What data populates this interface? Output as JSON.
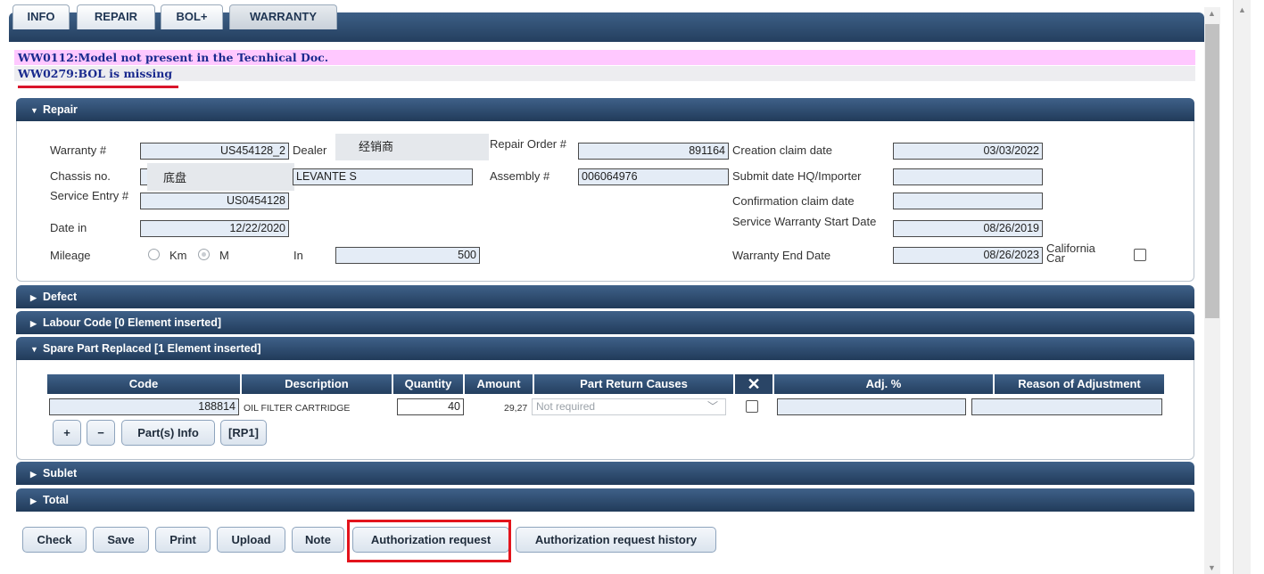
{
  "tabs": [
    "INFO",
    "REPAIR",
    "BOL+",
    "WARRANTY"
  ],
  "active_tab": "WARRANTY",
  "messages": [
    "WW0112:Model not present in the Tecnhical Doc.",
    "WW0279:BOL is missing"
  ],
  "sections": {
    "repair": "Repair",
    "defect": "Defect",
    "labour": "Labour Code  [0 Element inserted]",
    "spare": "Spare Part Replaced  [1 Element inserted]",
    "sublet": "Sublet",
    "total": "Total"
  },
  "repair": {
    "warranty_label": "Warranty #",
    "warranty_value": "US454128_2",
    "dealer_label": "Dealer",
    "dealer_value": "经销商",
    "repair_order_label": "Repair Order #",
    "repair_order_value": "891164",
    "creation_label": "Creation claim date",
    "creation_value": "03/03/2022",
    "chassis_label": "Chassis no.",
    "chassis_value": "底盘",
    "model_value": "LEVANTE S",
    "assembly_label": "Assembly #",
    "assembly_value": "006064976",
    "submit_label": "Submit date HQ/Importer",
    "submit_value": "",
    "service_entry_label": "Service Entry #",
    "service_entry_value": "US0454128",
    "confirmation_label": "Confirmation claim date",
    "confirmation_value": "",
    "date_in_label": "Date in",
    "date_in_value": "12/22/2020",
    "swsd_label": "Service Warranty Start Date",
    "swsd_value": "08/26/2019",
    "mileage_label": "Mileage",
    "km_label": "Km",
    "m_label": "M",
    "in_label": "In",
    "mileage_value": "500",
    "wed_label": "Warranty End Date",
    "wed_value": "08/26/2023",
    "california_label": "California Car"
  },
  "spare_table": {
    "headers": [
      "Code",
      "Description",
      "Quantity",
      "Amount",
      "Part Return Causes",
      "✕",
      "Adj. %",
      "Reason of Adjustment"
    ],
    "row": {
      "code": "188814",
      "description": "OIL FILTER CARTRIDGE",
      "quantity": "40",
      "amount": "29,27",
      "return_cause": "Not required"
    },
    "buttons": [
      "+",
      "−",
      "Part(s) Info",
      "[RP1]"
    ]
  },
  "bottom_buttons": [
    "Check",
    "Save",
    "Print",
    "Upload",
    "Note",
    "Authorization request",
    "Authorization request history"
  ],
  "colors": {
    "header": "#2c4a6e",
    "warning_bg": "#ffc8ff",
    "highlight": "#e3141c"
  }
}
